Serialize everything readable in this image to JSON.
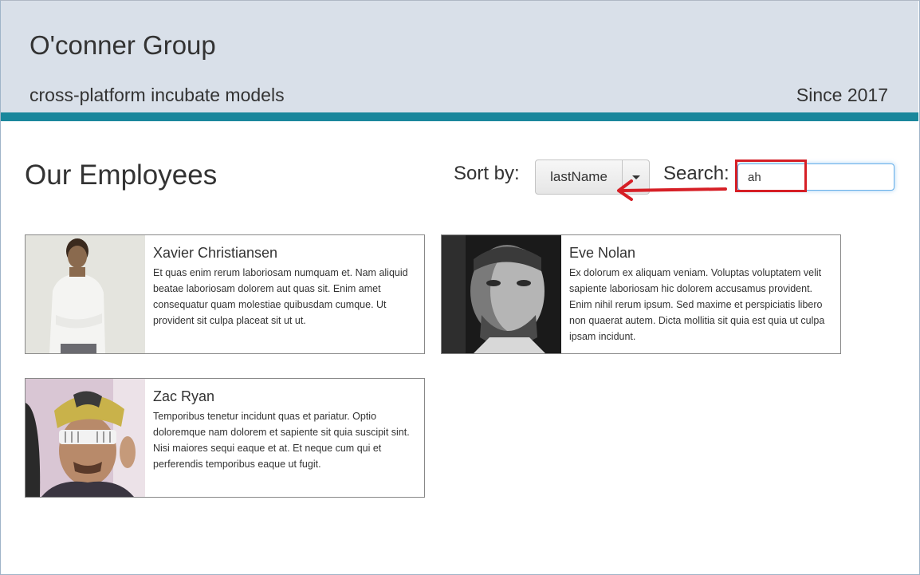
{
  "header": {
    "company": "O'conner Group",
    "tagline": "cross-platform incubate models",
    "since": "Since 2017"
  },
  "main": {
    "title": "Our Employees",
    "sort": {
      "label": "Sort by:",
      "value": "lastName"
    },
    "search": {
      "label": "Search:",
      "value": "ah"
    }
  },
  "employees": [
    {
      "name": "Xavier Christiansen",
      "bio": "Et quas enim rerum laboriosam numquam et. Nam aliquid beatae laboriosam dolorem aut quas sit. Enim amet consequatur quam molestiae quibusdam cumque. Ut provident sit culpa placeat sit ut ut."
    },
    {
      "name": "Eve Nolan",
      "bio": "Ex dolorum ex aliquam veniam. Voluptas voluptatem velit sapiente laboriosam hic dolorem accusamus provident. Enim nihil rerum ipsum. Sed maxime et perspiciatis libero non quaerat autem. Dicta mollitia sit quia est quia ut culpa ipsam incidunt."
    },
    {
      "name": "Zac Ryan",
      "bio": "Temporibus tenetur incidunt quas et pariatur. Optio doloremque nam dolorem et sapiente sit quia suscipit sint. Nisi maiores sequi eaque et at. Et neque cum qui et perferendis temporibus eaque ut fugit."
    }
  ],
  "colors": {
    "header_bg": "#d9e0e9",
    "header_stripe": "#1a879c",
    "annotation": "#d61f26"
  }
}
